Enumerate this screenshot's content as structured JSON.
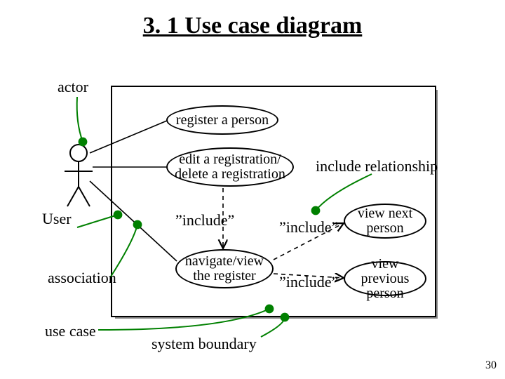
{
  "title": "3. 1 Use case diagram",
  "labels": {
    "actor": "actor",
    "user": "User",
    "association": "association",
    "usecase": "use case",
    "system_boundary": "system boundary",
    "include_rel": "include relationship",
    "include1": "”include”",
    "include2": "”include”",
    "include3": "”include”"
  },
  "usecases": {
    "register": "register a person",
    "edit": "edit a registration/\ndelete a registration",
    "navigate": "navigate/view\nthe register",
    "view_next": "view next\nperson",
    "view_prev": "view previous\nperson"
  },
  "page_number": "30"
}
